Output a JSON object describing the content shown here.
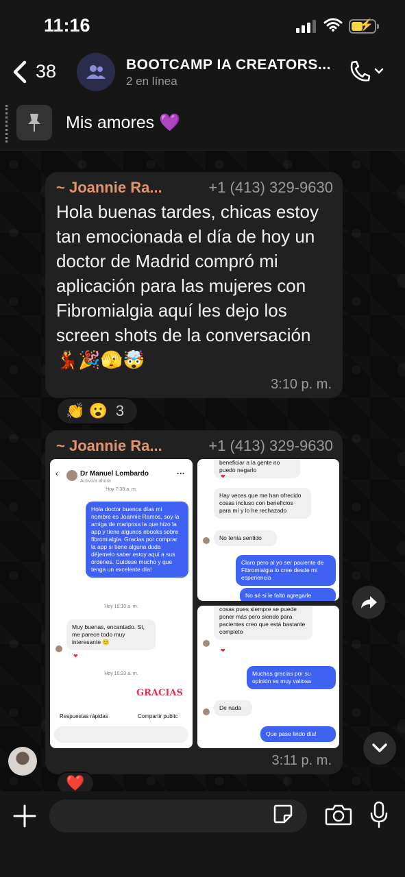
{
  "status_bar": {
    "time": "11:16"
  },
  "header": {
    "back_count": "38",
    "group_name": "BOOTCAMP IA CREATORS...",
    "subtitle": "2 en línea"
  },
  "pinned": {
    "text": "Mis amores 💜"
  },
  "messages": [
    {
      "sender": "~ Joannie Ra...",
      "phone": "+1 (413) 329-9630",
      "text": "Hola buenas tardes, chicas estoy tan emocionada el día de hoy un doctor de Madrid compró mi aplicación para las mujeres con Fibromialgia aquí les dejo los screen shots de la conversación 💃🎉🫣🤯",
      "time": "3:10 p. m.",
      "reactions": "👏 😮",
      "reaction_count": "3"
    },
    {
      "sender": "~ Joannie Ra...",
      "phone": "+1 (413) 329-9630",
      "time": "3:11 p. m.",
      "reaction": "❤️",
      "screenshot_left": {
        "contact": "Dr Manuel Lombardo",
        "status": "Activo/a ahora",
        "time1": "Hoy 7:38 a. m.",
        "msg1": "Hola doctor buenos días mi nombre es Joannie Ramos, soy la amiga de mariposa la que hizo la app y tiene algunos ebooks sobre fibromialgia. Gracias por comprar la app si tiene alguna duda déjemelo saber estoy aquí a sus órdenes. Cuídese mucho y que tenga un excelente día!",
        "time2": "Hoy 10:10 a. m.",
        "msg2": "Muy buenas, encantado. Sí, me parece todo muy interesante 😊",
        "time3": "Hoy 10:23 a. m.",
        "sticker": "GRACIAS",
        "quick1": "Respuestas rápidas",
        "quick2": "Compartir public"
      },
      "screenshot_right_top": {
        "msg1": "beneficiar a la gente no puedo negarlo",
        "msg2": "Hay veces que me han ofrecido cosas incluso con beneficios para mí y lo he rechazado",
        "msg3": "No tenía sentido",
        "msg4": "Claro pero al yo ser paciente de Fibromialgia lo cree desde mi esperiencia",
        "msg5": "No sé si le faltó agregarle"
      },
      "screenshot_right_bottom": {
        "msg1": "cosas pues siempre se puede poner más pero siendo para pacientes creo que está bastante completo",
        "msg2": "Muchas gracias por su opinión es muy valiosa",
        "msg3": "De nada",
        "msg4": "Que pase lindo día!"
      }
    }
  ]
}
